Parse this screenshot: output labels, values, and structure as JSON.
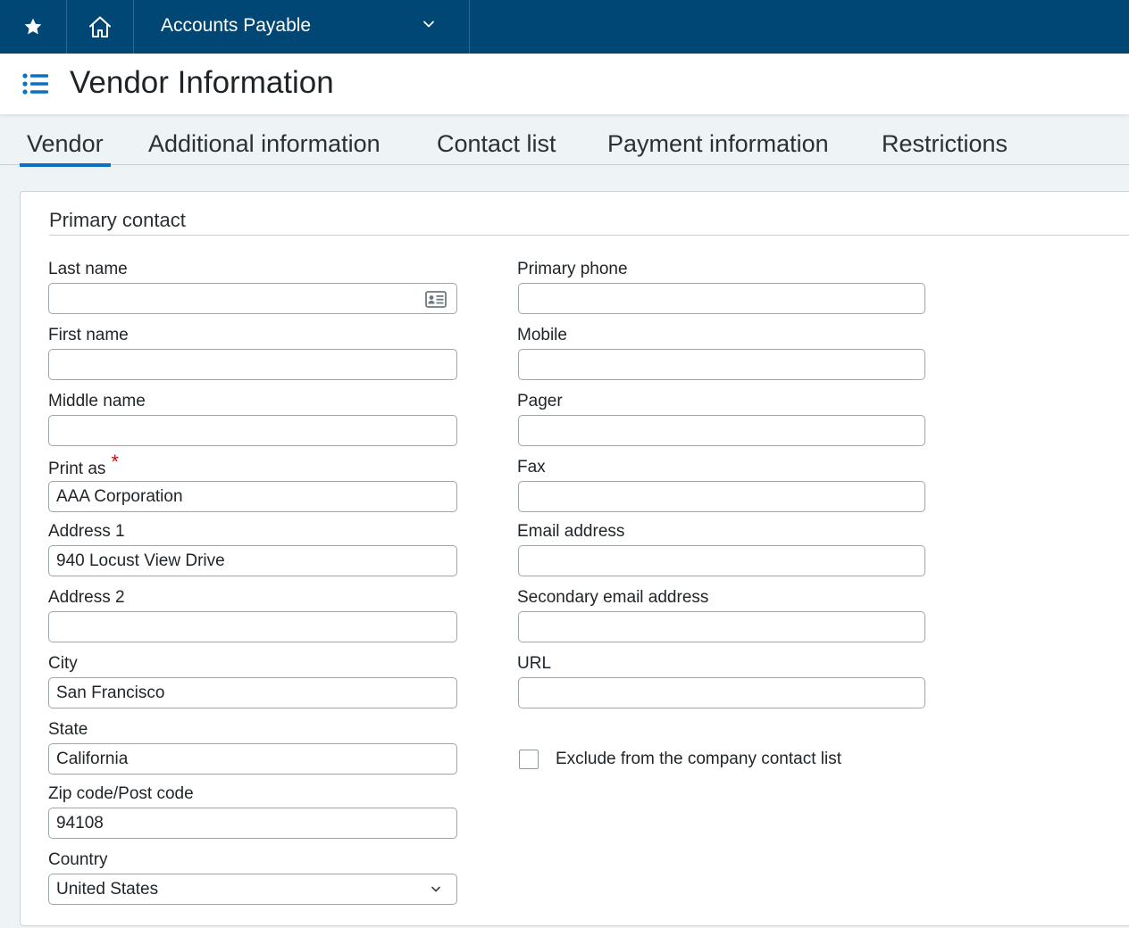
{
  "topbar": {
    "favorites_icon": "star-icon",
    "home_icon": "home-icon",
    "module": "Accounts Payable",
    "module_chevron_icon": "chevron-down-icon"
  },
  "header": {
    "menu_icon": "list-icon",
    "title": "Vendor Information"
  },
  "tabs": [
    {
      "label": "Vendor",
      "active": true
    },
    {
      "label": "Additional information",
      "active": false
    },
    {
      "label": "Contact list",
      "active": false
    },
    {
      "label": "Payment information",
      "active": false
    },
    {
      "label": "Restrictions",
      "active": false
    }
  ],
  "colors": {
    "topbar": "#004775",
    "accent": "#0a70c2",
    "required": "#c0101a"
  },
  "section": {
    "title": "Primary contact"
  },
  "left_fields": {
    "last_name": {
      "label": "Last name",
      "value": "",
      "icon": "contact-card-icon"
    },
    "first_name": {
      "label": "First name",
      "value": ""
    },
    "middle_name": {
      "label": "Middle name",
      "value": ""
    },
    "print_as": {
      "label": "Print as",
      "required_marker": "*",
      "value": "AAA Corporation"
    },
    "address1": {
      "label": "Address 1",
      "value": "940 Locust View Drive"
    },
    "address2": {
      "label": "Address 2",
      "value": ""
    },
    "city": {
      "label": "City",
      "value": "San Francisco"
    },
    "state": {
      "label": "State",
      "value": "California"
    },
    "zip": {
      "label": "Zip code/Post code",
      "value": "94108"
    },
    "country": {
      "label": "Country",
      "value": "United States",
      "icon": "chevron-down-icon"
    }
  },
  "right_fields": {
    "primary_phone": {
      "label": "Primary phone",
      "value": ""
    },
    "mobile": {
      "label": "Mobile",
      "value": ""
    },
    "pager": {
      "label": "Pager",
      "value": ""
    },
    "fax": {
      "label": "Fax",
      "value": ""
    },
    "email": {
      "label": "Email address",
      "value": ""
    },
    "secondary_email": {
      "label": "Secondary email address",
      "value": ""
    },
    "url": {
      "label": "URL",
      "value": ""
    }
  },
  "exclude_checkbox": {
    "label": "Exclude from the company contact list",
    "checked": false
  }
}
